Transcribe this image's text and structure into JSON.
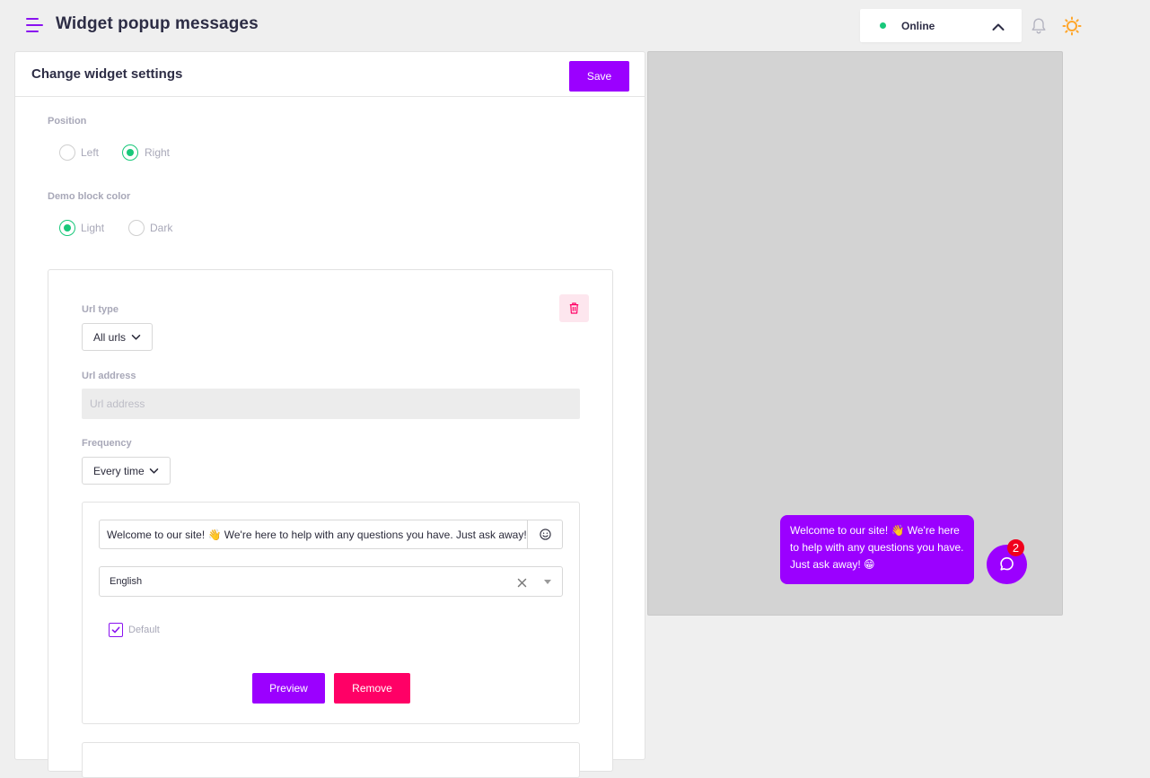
{
  "header": {
    "title": "Widget popup messages",
    "status": "Online",
    "status_color": "#18c87a",
    "icons": {
      "menu": "menu-icon",
      "bell": "bell-icon",
      "theme": "sun-icon"
    }
  },
  "settings": {
    "title": "Change widget settings",
    "save_label": "Save",
    "position": {
      "label": "Position",
      "options": [
        "Left",
        "Right"
      ],
      "selected": "Right"
    },
    "demo_block_color": {
      "label": "Demo block color",
      "options": [
        "Light",
        "Dark"
      ],
      "selected": "Light"
    }
  },
  "rule": {
    "url_type_label": "Url type",
    "url_type_value": "All urls",
    "url_address_label": "Url address",
    "url_address_placeholder": "Url address",
    "url_address_value": "",
    "frequency_label": "Frequency",
    "frequency_value": "Every time",
    "message": {
      "text": "Welcome to our site! 👋 We're here to help with any questions you have. Just ask away! 😁",
      "language": "English",
      "default_label": "Default",
      "default_checked": true,
      "preview_label": "Preview",
      "remove_label": "Remove"
    }
  },
  "preview": {
    "bubble_text": "Welcome to our site! 👋 We're here to help with any questions you have. Just ask away! 😁",
    "badge_count": "2"
  },
  "colors": {
    "accent": "#9b00ff",
    "danger": "#ff0066",
    "success": "#18c87a",
    "badge": "#f0001c"
  }
}
